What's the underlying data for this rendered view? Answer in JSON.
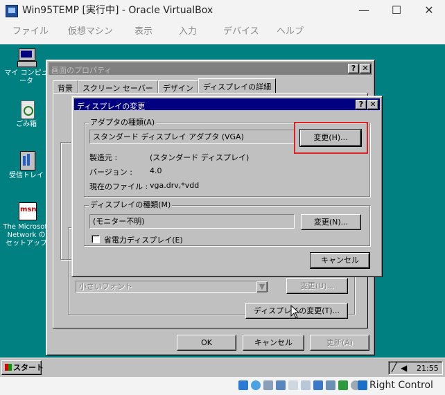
{
  "host": {
    "title": "Win95TEMP [実行中] - Oracle VirtualBox",
    "menu": [
      "ファイル",
      "仮想マシン",
      "表示",
      "入力",
      "デバイス",
      "ヘルプ"
    ],
    "controls": {
      "minimize": "—",
      "maximize": "☐",
      "close": "✕"
    },
    "status_text": "Right Control"
  },
  "desktop": {
    "icons": [
      {
        "label": "マイ コンピュータ",
        "icon": "computer-icon"
      },
      {
        "label": "ごみ箱",
        "icon": "recycle-bin-icon"
      },
      {
        "label": "受信トレイ",
        "icon": "inbox-icon"
      },
      {
        "label": "The Microsoft\nNetwork の\nセットアップ",
        "icon": "msn-icon"
      }
    ]
  },
  "props_window": {
    "title": "画面のプロパティ",
    "help_btn": "?",
    "close_btn": "✕",
    "tabs": [
      "背景",
      "スクリーン セーバー",
      "デザイン",
      "ディスプレイの詳細"
    ],
    "font_select": "小さいフォント",
    "font_change_btn": "変更(U)...",
    "display_change_btn": "ディスプレイの変更(T)...",
    "ok": "OK",
    "cancel": "キャンセル",
    "apply": "更新(A)"
  },
  "change_dialog": {
    "title": "ディスプレイの変更",
    "help_btn": "?",
    "close_btn": "✕",
    "adapter_group": "アダプタの種類(A)",
    "adapter_value": "スタンダード ディスプレイ アダプタ (VGA)",
    "adapter_change_btn": "変更(H)...",
    "maker_label": "製造元 :",
    "maker_value": "(スタンダード ディスプレイ)",
    "version_label": "バージョン :",
    "version_value": "4.0",
    "files_label": "現在のファイル :",
    "files_value": "vga.drv,*vdd",
    "monitor_group": "ディスプレイの種類(M)",
    "monitor_value": "(モニター不明)",
    "monitor_change_btn": "変更(N)...",
    "power_save_label": "省電力ディスプレイ(E)",
    "cancel": "キャンセル"
  },
  "taskbar": {
    "start": "スタート",
    "time": "21:55"
  },
  "colors": {
    "desktop": "#008080",
    "active_title": "#000080",
    "highlight": "#e02020"
  }
}
